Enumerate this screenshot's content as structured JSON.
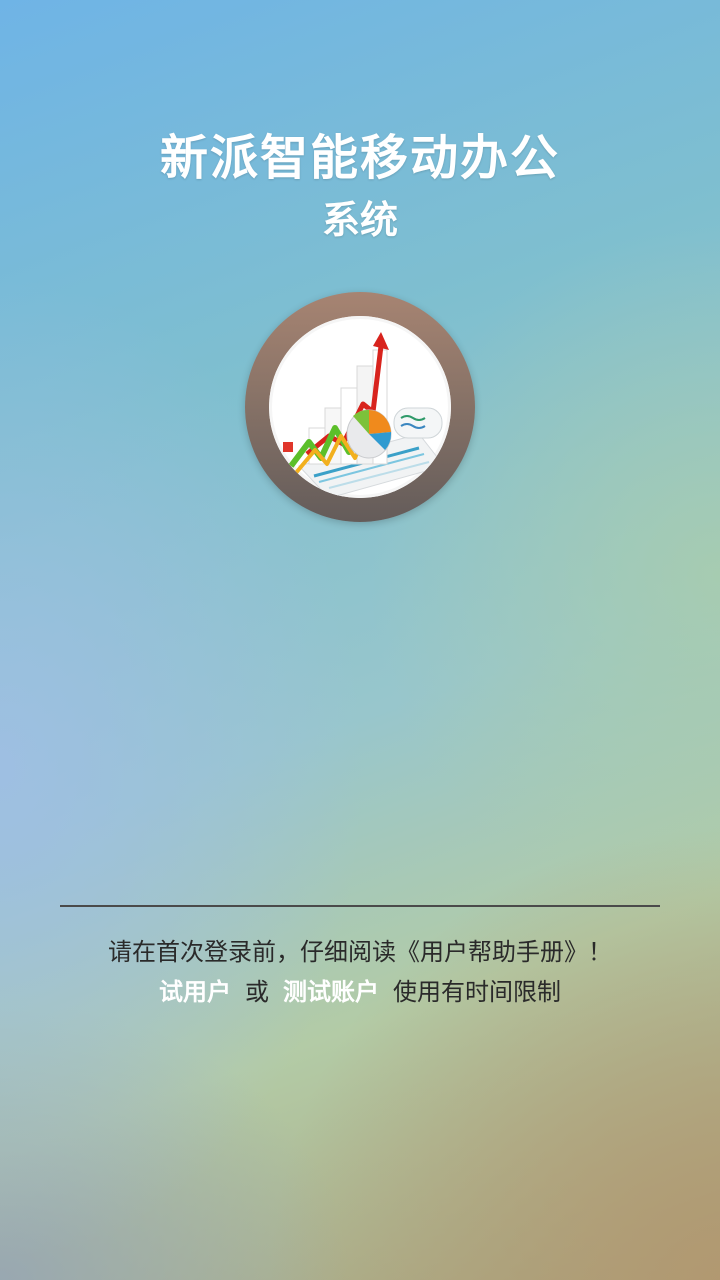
{
  "app": {
    "title": "新派智能移动办公",
    "subtitle": "系统",
    "logo": "analytics-chart-logo"
  },
  "notice": {
    "line1": "请在首次登录前，仔细阅读《用户帮助手册》！",
    "trial_user": "试用户",
    "or": "或",
    "test_account": "测试账户",
    "limit_text": "使用有时间限制"
  },
  "colors": {
    "highlight": "#ffffff",
    "body_text": "#2a2a2a",
    "divider": "#4a4a4a",
    "ring": "#857166"
  }
}
